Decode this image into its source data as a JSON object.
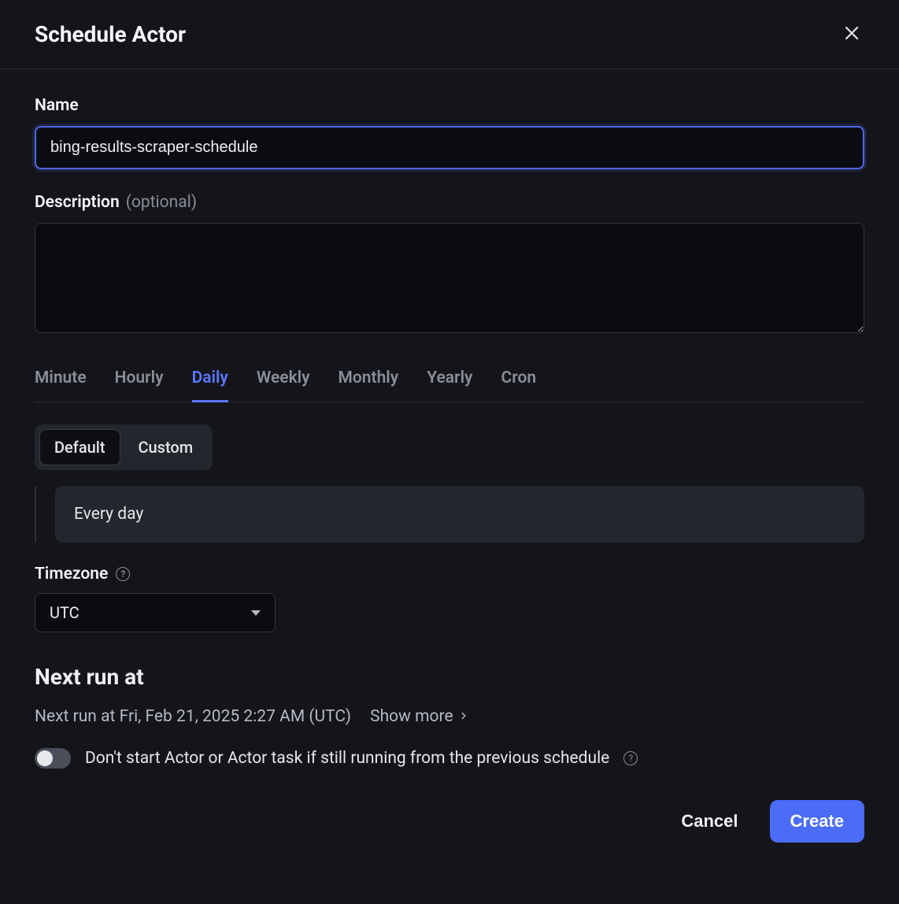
{
  "header": {
    "title": "Schedule Actor"
  },
  "name": {
    "label": "Name",
    "value": "bing-results-scraper-schedule"
  },
  "description": {
    "label": "Description",
    "optional": "(optional)",
    "value": ""
  },
  "tabs": {
    "items": [
      "Minute",
      "Hourly",
      "Daily",
      "Weekly",
      "Monthly",
      "Yearly",
      "Cron"
    ],
    "active": "Daily"
  },
  "segments": {
    "default": "Default",
    "custom": "Custom",
    "active": "Default"
  },
  "schedule_text": "Every day",
  "timezone": {
    "label": "Timezone",
    "value": "UTC"
  },
  "next_run": {
    "heading": "Next run at",
    "text": "Next run at Fri, Feb 21, 2025 2:27 AM (UTC)",
    "show_more": "Show more"
  },
  "toggle": {
    "label": "Don't start Actor or Actor task if still running from the previous schedule",
    "on": false
  },
  "footer": {
    "cancel": "Cancel",
    "create": "Create"
  }
}
